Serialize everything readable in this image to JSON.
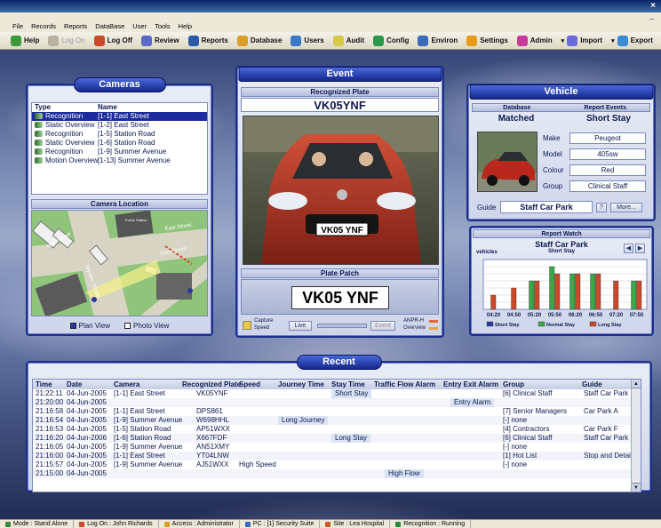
{
  "menu": [
    "File",
    "Records",
    "Reports",
    "DataBase",
    "User",
    "Tools",
    "Help"
  ],
  "toolbar": [
    {
      "label": "Help",
      "icon": "help-icon",
      "color": "#3a9a3a",
      "disabled": false
    },
    {
      "label": "Log On",
      "icon": "user-icon",
      "color": "#b8b0a0",
      "disabled": true
    },
    {
      "label": "Log Off",
      "icon": "user-icon",
      "color": "#c84a2a",
      "disabled": false
    },
    {
      "label": "Review",
      "icon": "review-icon",
      "color": "#5a6ac8",
      "disabled": false
    },
    {
      "label": "Reports",
      "icon": "reports-icon",
      "color": "#2a5aa8",
      "disabled": false
    },
    {
      "label": "Database",
      "icon": "database-icon",
      "color": "#d8a028",
      "disabled": false
    },
    {
      "label": "Users",
      "icon": "users-icon",
      "color": "#3a78c8",
      "disabled": false
    },
    {
      "label": "Audit",
      "icon": "audit-icon",
      "color": "#d8c848",
      "disabled": false
    },
    {
      "label": "Config",
      "icon": "config-icon",
      "color": "#2a9a4a",
      "disabled": false
    },
    {
      "label": "Environ",
      "icon": "globe-icon",
      "color": "#3a6ab8",
      "disabled": false
    },
    {
      "label": "Settings",
      "icon": "star-icon",
      "color": "#e89a18",
      "disabled": false
    },
    {
      "label": "Admin",
      "icon": "admin-icon",
      "color": "#c83a9a",
      "disabled": false
    },
    {
      "label": "Import",
      "icon": "import-icon",
      "color": "#6a6ad8",
      "disabled": false,
      "dropdown": true
    },
    {
      "label": "Export",
      "icon": "export-icon",
      "color": "#3a8ad8",
      "disabled": false,
      "dropdown": true
    }
  ],
  "cameras": {
    "title": "Cameras",
    "col_type": "Type",
    "col_name": "Name",
    "rows": [
      {
        "type": "Recognition",
        "name": "[1-1] East Street",
        "selected": true
      },
      {
        "type": "Static Overview",
        "name": "[1-2] East Street",
        "selected": false
      },
      {
        "type": "Recognition",
        "name": "[1-5] Station Road",
        "selected": false
      },
      {
        "type": "Static Overview",
        "name": "[1-6] Station Road",
        "selected": false
      },
      {
        "type": "Recognition",
        "name": "[1-9] Summer Avenue",
        "selected": false
      },
      {
        "type": "Motion Overview",
        "name": "[1-13] Summer Avenue",
        "selected": false
      }
    ],
    "location_label": "Camera  Location",
    "map_labels": [
      "High Street",
      "East Street",
      "East Street",
      "Wyvern Street",
      "Police Station"
    ],
    "plan_view": "Plan View",
    "photo_view": "Photo View"
  },
  "event": {
    "title": "Event",
    "plate_header": "Recognized Plate",
    "plate": "VK05YNF",
    "car_plate": "VK05 YNF",
    "patch_label": "Plate  Patch",
    "patch_plate": "VK05 YNF",
    "capture_label": "Capture",
    "speed_label": "Speed",
    "live_btn": "Live",
    "event_btn": "Event",
    "anpr_label": "ANPR-H",
    "overview_label": "Overview"
  },
  "vehicle": {
    "title": "Vehicle",
    "database_label": "Database",
    "report_events_label": "Report  Events",
    "matched": "Matched",
    "short_stay": "Short Stay",
    "fields": [
      {
        "label": "Make",
        "value": "Peugeot"
      },
      {
        "label": "Model",
        "value": "405sw"
      },
      {
        "label": "Colour",
        "value": "Red"
      },
      {
        "label": "Group",
        "value": "Clinical Staff"
      }
    ],
    "guide_label": "Guide",
    "guide_value": "Staff Car Park",
    "more_btn": "More..."
  },
  "watch": {
    "title": "Report  Watch",
    "chart_title": "Staff Car Park",
    "chart_subtitle": "Short Stay",
    "ylabel": "vehicles"
  },
  "chart_data": {
    "type": "bar",
    "categories": [
      "04:20",
      "04:50",
      "05:20",
      "05:50",
      "06:20",
      "06:50",
      "07:20",
      "07:50"
    ],
    "series": [
      {
        "name": "Short Stay",
        "color": "#2a3a9a",
        "values": [
          0,
          0,
          0,
          0,
          0,
          0,
          0,
          0
        ]
      },
      {
        "name": "Normal Stay",
        "color": "#3aa848",
        "values": [
          0,
          0,
          4,
          6,
          5,
          5,
          0,
          4
        ]
      },
      {
        "name": "Long Stay",
        "color": "#c84a2a",
        "values": [
          2,
          3,
          4,
          5,
          5,
          5,
          4,
          4
        ]
      }
    ],
    "ylim": [
      0,
      7
    ],
    "legend": "bottom"
  },
  "recent": {
    "title": "Recent",
    "headers": [
      "Time",
      "Date",
      "Camera",
      "Recognized Plate",
      "Speed",
      "Journey Time",
      "Stay Time",
      "Traffic Flow Alarm",
      "Entry Exit Alarm",
      "Group",
      "Guide"
    ],
    "rows": [
      {
        "time": "21:22:11",
        "date": "04-Jun-2005",
        "camera": "[1-1] East Street",
        "plate": "VK05YNF",
        "speed": "",
        "journey": "",
        "stay": "Short Stay",
        "flow": "",
        "entry": "",
        "group": "[6] Clinical Staff",
        "guide": "Staff Car Park"
      },
      {
        "time": "21:20:00",
        "date": "04-Jun-2005",
        "camera": "",
        "plate": "",
        "speed": "",
        "journey": "",
        "stay": "",
        "flow": "",
        "entry": "Entry Alarm",
        "group": "",
        "guide": ""
      },
      {
        "time": "21:16:58",
        "date": "04-Jun-2005",
        "camera": "[1-1] East Street",
        "plate": "DPS861",
        "speed": "",
        "journey": "",
        "stay": "",
        "flow": "",
        "entry": "",
        "group": "[7] Senior Managers",
        "guide": "Car Park A"
      },
      {
        "time": "21:16:54",
        "date": "04-Jun-2005",
        "camera": "[1-9] Summer Avenue",
        "plate": "W698HHL",
        "speed": "",
        "journey": "Long Journey",
        "stay": "",
        "flow": "",
        "entry": "",
        "group": "[-] none",
        "guide": ""
      },
      {
        "time": "21:16:53",
        "date": "04-Jun-2005",
        "camera": "[1-5] Station Road",
        "plate": "AP51WXX",
        "speed": "",
        "journey": "",
        "stay": "",
        "flow": "",
        "entry": "",
        "group": "[4] Contractors",
        "guide": "Car Park F"
      },
      {
        "time": "21:16:20",
        "date": "04-Jun-2006",
        "camera": "[1-6] Station Road",
        "plate": "X667FDF",
        "speed": "",
        "journey": "",
        "stay": "Long Stay",
        "flow": "",
        "entry": "",
        "group": "[6] Clinical Staff",
        "guide": "Staff Car Park"
      },
      {
        "time": "21:16:05",
        "date": "04-Jun-2005",
        "camera": "[1-9] Summer Avenue",
        "plate": "AN51XMY",
        "speed": "",
        "journey": "",
        "stay": "",
        "flow": "",
        "entry": "",
        "group": "[-] none",
        "guide": ""
      },
      {
        "time": "21:16:00",
        "date": "04-Jun-2005",
        "camera": "[1-1] East Street",
        "plate": "YT04LNW",
        "speed": "",
        "journey": "",
        "stay": "",
        "flow": "",
        "entry": "",
        "group": "[1] Hot List",
        "guide": "Stop  and Detain"
      },
      {
        "time": "21:15:57",
        "date": "04-Jun-2005",
        "camera": "[1-9] Summer Avenue",
        "plate": "AJ51WXX",
        "speed": "High Speed",
        "journey": "",
        "stay": "",
        "flow": "",
        "entry": "",
        "group": "[-] none",
        "guide": ""
      },
      {
        "time": "21:15:00",
        "date": "04-Jun-2005",
        "camera": "",
        "plate": "",
        "speed": "",
        "journey": "",
        "stay": "",
        "flow": "High Flow",
        "entry": "",
        "group": "",
        "guide": ""
      }
    ]
  },
  "status": [
    {
      "text": "Mode : Stand Alone",
      "color": "#3a8a3a"
    },
    {
      "text": "Log On : John Richards",
      "color": "#c84a2a"
    },
    {
      "text": "Access : Administrator",
      "color": "#d8a028"
    },
    {
      "text": "PC : [1] Security Suite",
      "color": "#3a6ab8"
    },
    {
      "text": "Site : Lea Hospital",
      "color": "#c85a2a"
    },
    {
      "text": "Recognition : Running",
      "color": "#2a8a3a"
    }
  ]
}
